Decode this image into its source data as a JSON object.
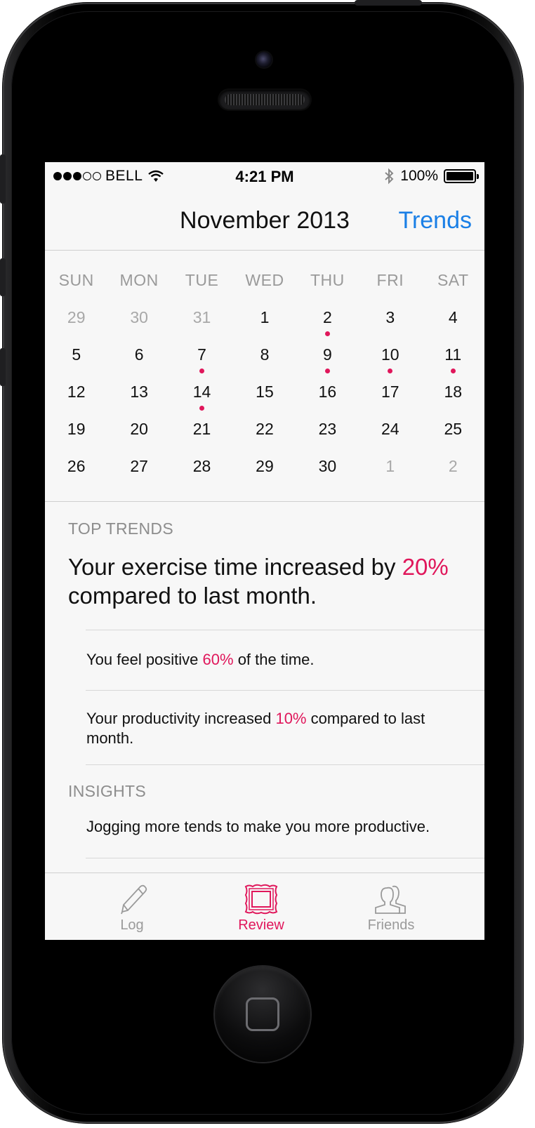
{
  "status_bar": {
    "carrier": "BELL",
    "time": "4:21 PM",
    "battery": "100%",
    "signal_bars": 3,
    "signal_total": 5
  },
  "nav": {
    "title": "November 2013",
    "action": "Trends"
  },
  "calendar": {
    "weekdays": [
      "SUN",
      "MON",
      "TUE",
      "WED",
      "THU",
      "FRI",
      "SAT"
    ],
    "weeks": [
      [
        {
          "d": "29",
          "muted": true
        },
        {
          "d": "30",
          "muted": true
        },
        {
          "d": "31",
          "muted": true
        },
        {
          "d": "1"
        },
        {
          "d": "2",
          "marked": true
        },
        {
          "d": "3"
        },
        {
          "d": "4"
        }
      ],
      [
        {
          "d": "5"
        },
        {
          "d": "6"
        },
        {
          "d": "7",
          "marked": true
        },
        {
          "d": "8"
        },
        {
          "d": "9",
          "marked": true
        },
        {
          "d": "10",
          "marked": true
        },
        {
          "d": "11",
          "marked": true
        }
      ],
      [
        {
          "d": "12"
        },
        {
          "d": "13"
        },
        {
          "d": "14",
          "marked": true
        },
        {
          "d": "15"
        },
        {
          "d": "16"
        },
        {
          "d": "17"
        },
        {
          "d": "18"
        }
      ],
      [
        {
          "d": "19"
        },
        {
          "d": "20"
        },
        {
          "d": "21"
        },
        {
          "d": "22"
        },
        {
          "d": "23"
        },
        {
          "d": "24"
        },
        {
          "d": "25"
        }
      ],
      [
        {
          "d": "26"
        },
        {
          "d": "27"
        },
        {
          "d": "28"
        },
        {
          "d": "29"
        },
        {
          "d": "30"
        },
        {
          "d": "1",
          "muted": true
        },
        {
          "d": "2",
          "muted": true
        }
      ]
    ]
  },
  "top_trends": {
    "label": "TOP TRENDS",
    "headline": {
      "before": "Your exercise time increased by ",
      "value": "20%",
      "after": " compared to last month."
    },
    "items": [
      {
        "before": "You feel positive ",
        "value": "60%",
        "after": " of the time."
      },
      {
        "before": "Your productivity increased ",
        "value": "10%",
        "after": " compared to last month."
      }
    ]
  },
  "insights": {
    "label": "INSIGHTS",
    "items": [
      "Jogging more tends to make you more productive."
    ]
  },
  "tabs": [
    {
      "label": "Log",
      "icon": "pencil-icon",
      "active": false
    },
    {
      "label": "Review",
      "icon": "picture-frame-icon",
      "active": true
    },
    {
      "label": "Friends",
      "icon": "friends-icon",
      "active": false
    }
  ],
  "colors": {
    "accent": "#e0175b",
    "link": "#1a7fe6",
    "muted": "#9a9a9a",
    "background": "#f7f7f7"
  }
}
